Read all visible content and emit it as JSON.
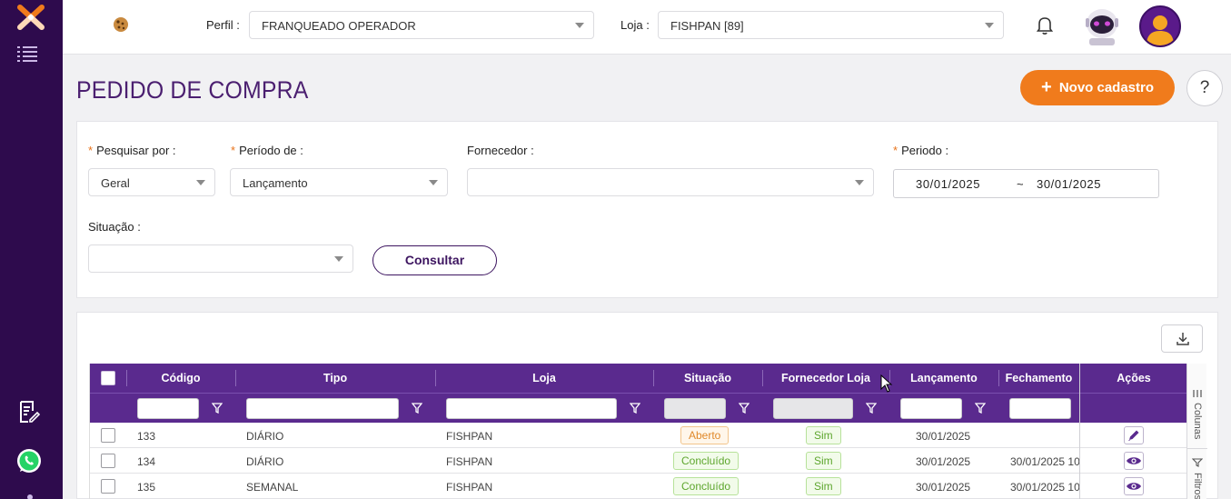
{
  "header": {
    "profile_label": "Perfil :",
    "profile_value": "FRANQUEADO OPERADOR",
    "store_label": "Loja :",
    "store_value": "FISHPAN [89]"
  },
  "page": {
    "title": "PEDIDO DE COMPRA",
    "new_button": "Novo cadastro",
    "help_button": "?"
  },
  "filters": {
    "search_by_label": "Pesquisar por :",
    "search_by_value": "Geral",
    "period_of_label": "Período de :",
    "period_of_value": "Lançamento",
    "supplier_label": "Fornecedor :",
    "supplier_value": "",
    "period_label": "Periodo :",
    "date_from": "30/01/2025",
    "date_sep": "~",
    "date_to": "30/01/2025",
    "status_label": "Situação :",
    "status_value": "",
    "consult_button": "Consultar"
  },
  "table": {
    "columns": [
      "Código",
      "Tipo",
      "Loja",
      "Situação",
      "Fornecedor Loja",
      "Lançamento",
      "Fechamento",
      "Ações"
    ],
    "rows": [
      {
        "codigo": "133",
        "tipo": "DIÁRIO",
        "loja": "FISHPAN",
        "situacao": "Aberto",
        "situacao_kind": "open",
        "fornecedor_loja": "Sim",
        "lancamento": "30/01/2025",
        "fechamento": "",
        "acao": "edit-icon"
      },
      {
        "codigo": "134",
        "tipo": "DIÁRIO",
        "loja": "FISHPAN",
        "situacao": "Concluído",
        "situacao_kind": "done",
        "fornecedor_loja": "Sim",
        "lancamento": "30/01/2025",
        "fechamento": "30/01/2025 10",
        "acao": "eye-icon"
      },
      {
        "codigo": "135",
        "tipo": "SEMANAL",
        "loja": "FISHPAN",
        "situacao": "Concluído",
        "situacao_kind": "done",
        "fornecedor_loja": "Sim",
        "lancamento": "30/01/2025",
        "fechamento": "30/01/2025 10",
        "acao": "eye-icon"
      }
    ],
    "side_tabs": [
      "Colunas",
      "Filtros"
    ]
  },
  "colors": {
    "sidebar": "#2e0b4d",
    "accent": "#f07b1c",
    "table_header": "#5a2a8e",
    "title": "#4b1f70"
  }
}
